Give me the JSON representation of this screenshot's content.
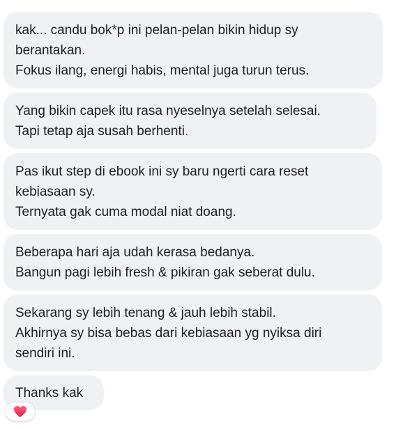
{
  "messages": [
    {
      "lines": [
        "kak... candu bok*p ini pelan-pelan bikin hidup sy",
        "berantakan.",
        "Fokus ilang, energi habis, mental juga turun terus."
      ]
    },
    {
      "lines": [
        "Yang bikin capek itu rasa nyeselnya setelah selesai.",
        "Tapi tetap aja susah berhenti."
      ]
    },
    {
      "lines": [
        "Pas ikut step di ebook ini sy baru ngerti cara reset",
        "kebiasaan sy.",
        "Ternyata gak cuma modal niat doang."
      ]
    },
    {
      "lines": [
        "Beberapa hari aja udah kerasa bedanya.",
        "Bangun pagi lebih fresh & pikiran gak seberat dulu."
      ]
    },
    {
      "lines": [
        "Sekarang sy lebih tenang & jauh lebih stabil.",
        "Akhirnya sy bisa bebas dari kebiasaan yg nyiksa diri",
        "sendiri ini."
      ]
    },
    {
      "lines": [
        "Thanks kak"
      ]
    }
  ],
  "reaction": {
    "icon": "heart-icon",
    "color": "#e8325a"
  },
  "colors": {
    "bubble": "#f0f1f5",
    "text": "#1c1e21"
  }
}
